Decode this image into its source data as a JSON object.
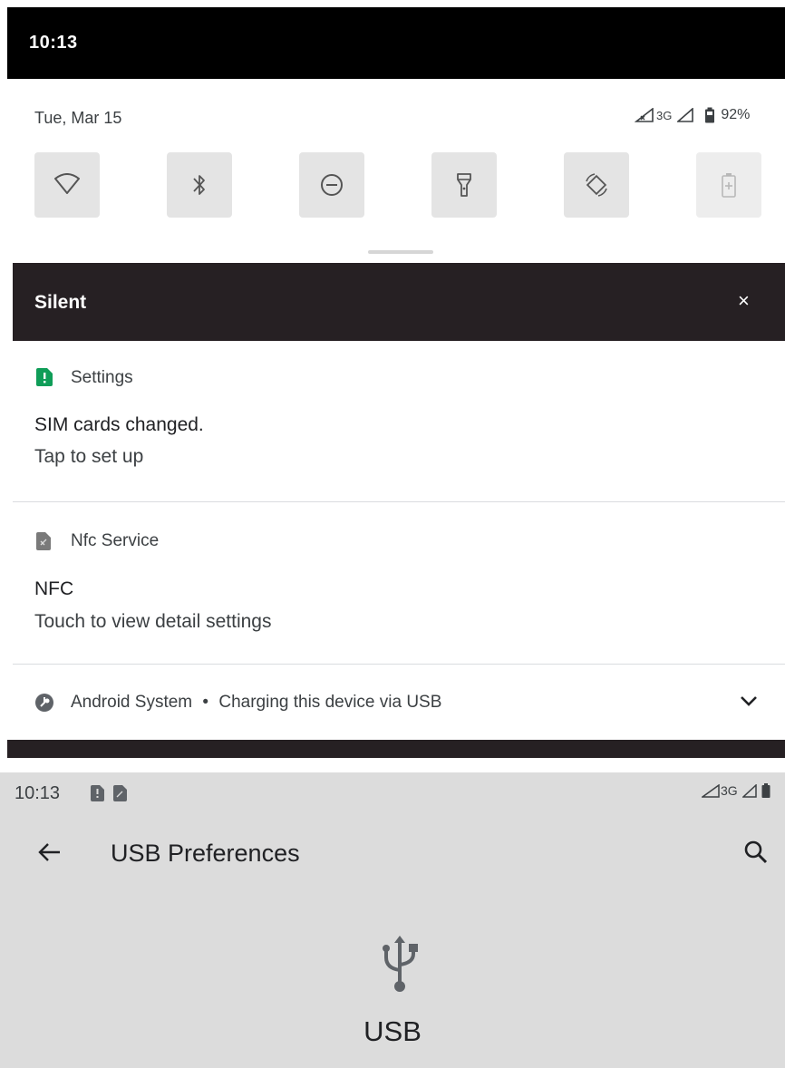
{
  "status_bar": {
    "time": "10:13"
  },
  "quick_settings": {
    "date": "Tue, Mar 15",
    "network_type": "3G",
    "battery": "92%",
    "tiles": [
      {
        "name": "wifi",
        "icon": "wifi-icon"
      },
      {
        "name": "bluetooth",
        "icon": "bluetooth-icon"
      },
      {
        "name": "do-not-disturb",
        "icon": "do-not-disturb-icon"
      },
      {
        "name": "flashlight",
        "icon": "flashlight-icon"
      },
      {
        "name": "auto-rotate",
        "icon": "auto-rotate-icon"
      },
      {
        "name": "battery-saver",
        "icon": "battery-saver-icon"
      }
    ]
  },
  "silent_section": {
    "title": "Silent",
    "close_glyph": "×"
  },
  "notifications": [
    {
      "app": "Settings",
      "title": "SIM cards changed.",
      "body": "Tap to set up",
      "icon": "sim-alert-icon",
      "icon_color": "#0f9d58"
    },
    {
      "app": "Nfc Service",
      "title": "NFC",
      "body": "Touch to view detail settings",
      "icon": "nfc-icon"
    },
    {
      "app": "Android System",
      "separator": "•",
      "summary": "Charging this device via USB",
      "icon": "android-system-icon"
    }
  ],
  "usb_screen": {
    "time": "10:13",
    "network_type": "3G",
    "title": "USB Preferences",
    "label": "USB"
  }
}
